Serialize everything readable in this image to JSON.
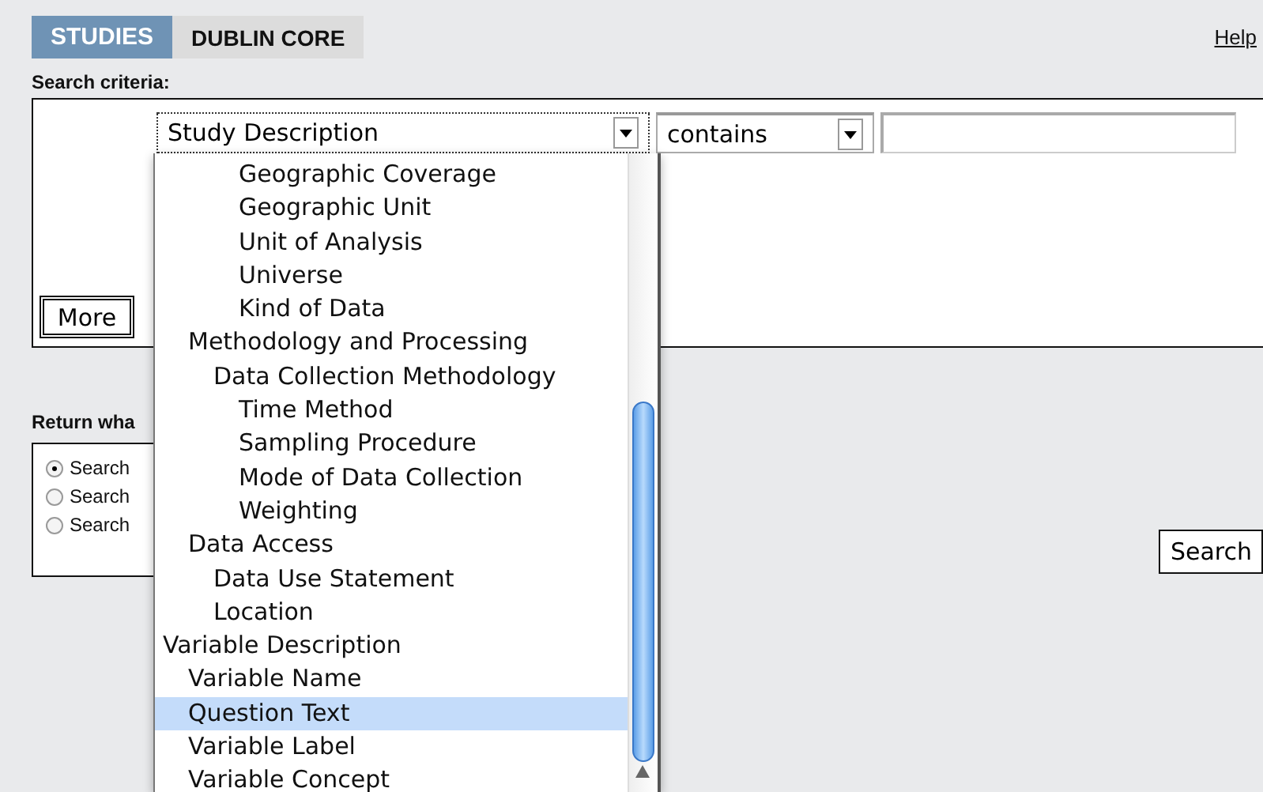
{
  "tabs": [
    {
      "label": "STUDIES",
      "selected": true
    },
    {
      "label": "DUBLIN CORE",
      "selected": false
    }
  ],
  "help_link": "Help",
  "search_criteria": {
    "label": "Search criteria:",
    "field_select": {
      "value": "Study Description"
    },
    "operator_select": {
      "value": "contains"
    },
    "more_button": "More"
  },
  "return_what": {
    "label": "Return wha",
    "options": [
      {
        "label": "Search",
        "selected": true
      },
      {
        "label": "Search",
        "selected": false
      },
      {
        "label": "Search",
        "selected": false
      }
    ]
  },
  "search_button": "Search",
  "dropdown": {
    "options": [
      {
        "children": [
          {
            "children": [
              {
                "children": [
                  {
                    "label": "Geographic Coverage",
                    "selected": false
                  },
                  {
                    "label": "Geographic Unit",
                    "selected": false
                  },
                  {
                    "label": "Unit of Analysis",
                    "selected": false
                  },
                  {
                    "label": "Universe",
                    "selected": false
                  },
                  {
                    "label": "Kind of Data",
                    "selected": false
                  }
                ]
              }
            ]
          },
          {
            "label": "Methodology and Processing",
            "selected": false,
            "children": [
              {
                "label": "Data Collection Methodology",
                "selected": false,
                "children": [
                  {
                    "label": "Time Method",
                    "selected": false
                  },
                  {
                    "label": "Sampling Procedure",
                    "selected": false
                  },
                  {
                    "label": "Mode of Data Collection",
                    "selected": false
                  },
                  {
                    "label": "Weighting",
                    "selected": false
                  }
                ]
              }
            ]
          },
          {
            "label": "Data Access",
            "selected": false,
            "children": [
              {
                "label": "Data Use Statement",
                "selected": false
              },
              {
                "label": "Location",
                "selected": false
              }
            ]
          }
        ]
      },
      {
        "label": "Variable Description",
        "selected": false,
        "children": [
          {
            "label": "Variable Name",
            "selected": false
          },
          {
            "label": "Question Text",
            "selected": true
          },
          {
            "label": "Variable Label",
            "selected": false
          },
          {
            "label": "Variable Concept",
            "selected": false
          }
        ]
      }
    ]
  }
}
